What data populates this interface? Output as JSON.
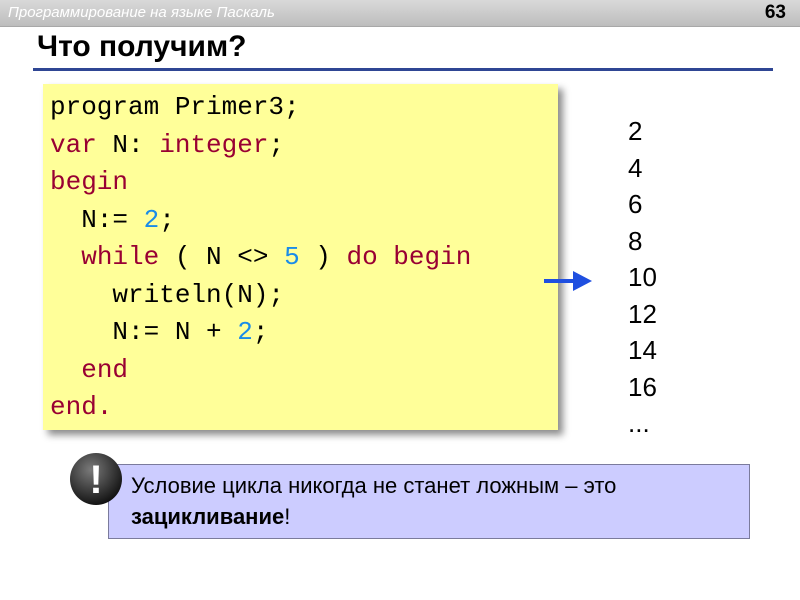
{
  "header": {
    "course_title": "Программирование на языке Паскаль",
    "page_number": "63"
  },
  "slide": {
    "title": "Что получим?"
  },
  "code": {
    "lines": [
      [
        {
          "t": "program Primer3;",
          "c": "plain"
        }
      ],
      [
        {
          "t": "var",
          "c": "kw"
        },
        {
          "t": " N: ",
          "c": "plain"
        },
        {
          "t": "integer",
          "c": "kw"
        },
        {
          "t": ";",
          "c": "plain"
        }
      ],
      [
        {
          "t": "begin",
          "c": "kw"
        }
      ],
      [
        {
          "t": "  N:= ",
          "c": "plain"
        },
        {
          "t": "2",
          "c": "num"
        },
        {
          "t": ";",
          "c": "plain"
        }
      ],
      [
        {
          "t": "  ",
          "c": "plain"
        },
        {
          "t": "while",
          "c": "kw"
        },
        {
          "t": " ( N <> ",
          "c": "plain"
        },
        {
          "t": "5",
          "c": "num"
        },
        {
          "t": " ) ",
          "c": "plain"
        },
        {
          "t": "do begin",
          "c": "kw"
        }
      ],
      [
        {
          "t": "    writeln(N);",
          "c": "plain"
        }
      ],
      [
        {
          "t": "    N:= N + ",
          "c": "plain"
        },
        {
          "t": "2",
          "c": "num"
        },
        {
          "t": ";",
          "c": "plain"
        }
      ],
      [
        {
          "t": "  ",
          "c": "plain"
        },
        {
          "t": "end",
          "c": "kw"
        }
      ],
      [
        {
          "t": "end.",
          "c": "kw"
        }
      ]
    ]
  },
  "output": {
    "values": [
      "2",
      "4",
      "6",
      "8",
      "10",
      "12",
      "14",
      "16",
      "..."
    ]
  },
  "note": {
    "icon_symbol": "!",
    "text": "Условие цикла никогда не станет ложным – это",
    "bold_text": "зацикливание",
    "suffix": "!"
  },
  "colors": {
    "keyword": "#990033",
    "number": "#1a8ce8",
    "code_background": "#ffff99",
    "note_background": "#ccccff",
    "title_rule": "#2f4694",
    "arrow": "#1f4fe0"
  }
}
